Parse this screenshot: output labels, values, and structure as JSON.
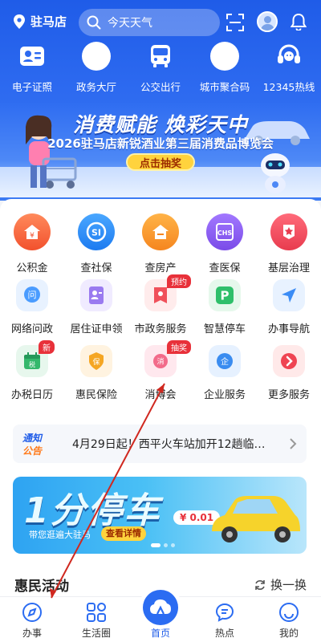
{
  "topbar": {
    "location": "驻马店",
    "search_placeholder": "今天天气"
  },
  "quick_links": [
    {
      "label": "电子证照",
      "icon": "id-card-icon"
    },
    {
      "label": "政务大厅",
      "icon": "blank-circle-icon"
    },
    {
      "label": "公交出行",
      "icon": "bus-icon"
    },
    {
      "label": "城市聚合码",
      "icon": "blank-circle-icon"
    },
    {
      "label": "12345热线",
      "icon": "headset-icon"
    }
  ],
  "banner": {
    "title": "消费赋能 焕彩天中",
    "subtitle": "2026驻马店新锐酒业第三届消费品博览会",
    "button": "点击抽奖"
  },
  "services": [
    {
      "label": "公积金",
      "icon": "house-fund-icon"
    },
    {
      "label": "查社保",
      "icon": "social-security-icon"
    },
    {
      "label": "查房产",
      "icon": "property-icon"
    },
    {
      "label": "查医保",
      "icon": "medical-insurance-icon"
    },
    {
      "label": "基层治理",
      "icon": "governance-icon"
    },
    {
      "label": "网络问政",
      "icon": "inquiry-icon"
    },
    {
      "label": "居住证申领",
      "icon": "residence-permit-icon"
    },
    {
      "label": "市政务服务",
      "icon": "government-service-icon",
      "badge": "预约"
    },
    {
      "label": "智慧停车",
      "icon": "parking-icon"
    },
    {
      "label": "办事导航",
      "icon": "navigation-icon"
    },
    {
      "label": "办税日历",
      "icon": "tax-calendar-icon",
      "badge": "新"
    },
    {
      "label": "惠民保险",
      "icon": "insurance-icon"
    },
    {
      "label": "消博会",
      "icon": "expo-icon",
      "badge": "抽奖"
    },
    {
      "label": "企业服务",
      "icon": "enterprise-icon"
    },
    {
      "label": "更多服务",
      "icon": "more-icon"
    }
  ],
  "notice": {
    "tag_top": "通知",
    "tag_bottom": "公告",
    "text": "4月29日起！西平火车站加开12趟临…"
  },
  "ad": {
    "headline": "1分停车",
    "tagline": "带您逛遍大驻马",
    "detail": "查看详情",
    "price": "¥ 0.01"
  },
  "section": {
    "title": "惠民活动",
    "refresh": "换一换"
  },
  "nav": [
    {
      "label": "办事",
      "icon": "compass-icon"
    },
    {
      "label": "生活圈",
      "icon": "grid-icon"
    },
    {
      "label": "首页",
      "icon": "home-cloud-icon",
      "active": true
    },
    {
      "label": "热点",
      "icon": "chat-bubble-icon"
    },
    {
      "label": "我的",
      "icon": "profile-icon"
    }
  ]
}
